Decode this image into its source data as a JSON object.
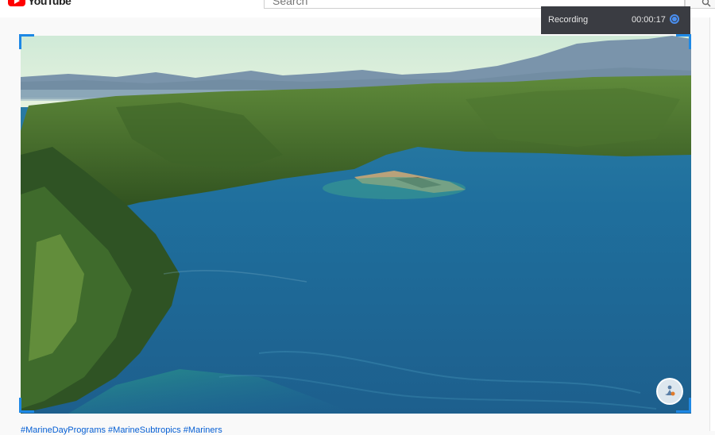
{
  "header": {
    "logo_text": "YouTube",
    "search_placeholder": "Search"
  },
  "recorder": {
    "label": "Recording",
    "elapsed": "00:00:17",
    "accent": "#4a8ff0"
  },
  "video": {
    "hashtags": "#MarineDayPrograms #MarineSubtropics #Mariners"
  },
  "colors": {
    "selection_corners": "#1e88e5",
    "link": "#065fd4"
  }
}
